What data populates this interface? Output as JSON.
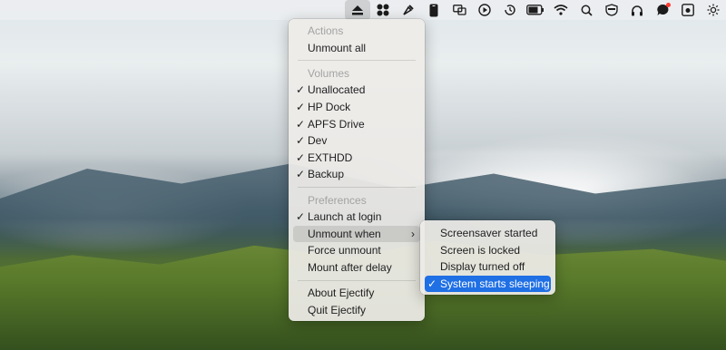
{
  "menubar": {
    "icons": [
      "eject-icon",
      "cmd-icon",
      "paintbrush-icon",
      "phone-icon",
      "screens-icon",
      "play-icon",
      "history-icon",
      "battery-icon",
      "wifi-icon",
      "search-icon",
      "shield-icon",
      "headphones-icon",
      "chat-icon",
      "camera-icon",
      "sun-icon"
    ]
  },
  "menu": {
    "actions_header": "Actions",
    "unmount_all": "Unmount all",
    "volumes_header": "Volumes",
    "volumes": [
      {
        "label": "Unallocated",
        "checked": true
      },
      {
        "label": "HP Dock",
        "checked": true
      },
      {
        "label": "APFS Drive",
        "checked": true
      },
      {
        "label": "Dev",
        "checked": true
      },
      {
        "label": "EXTHDD",
        "checked": true
      },
      {
        "label": "Backup",
        "checked": true
      }
    ],
    "preferences_header": "Preferences",
    "launch_at_login": "Launch at login",
    "unmount_when": "Unmount when",
    "force_unmount": "Force unmount",
    "mount_after_delay": "Mount after delay",
    "about": "About Ejectify",
    "quit": "Quit Ejectify",
    "check_glyph": "✓",
    "arrow_glyph": "›"
  },
  "submenu": {
    "screensaver": "Screensaver started",
    "screen_locked": "Screen is locked",
    "display_off": "Display turned off",
    "system_sleeping": "System starts sleeping"
  },
  "colors": {
    "accent": "#1f6fe5"
  }
}
